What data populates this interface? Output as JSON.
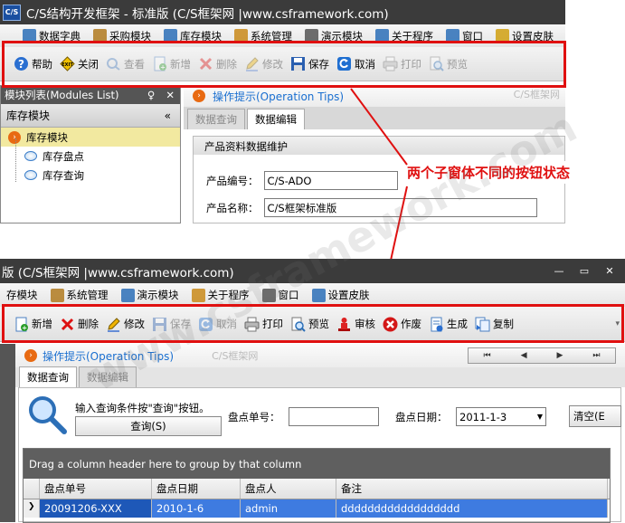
{
  "window1": {
    "app_icon_text": "C/S",
    "title": "C/S结构开发框架 - 标准版 (C/S框架网 |www.csframework.com)",
    "menu": [
      "数据字典",
      "采购模块",
      "库存模块",
      "系统管理",
      "演示模块",
      "关于程序",
      "窗口",
      "设置皮肤"
    ],
    "toolbar": [
      {
        "label": "帮助",
        "icon": "help-icon",
        "enabled": true
      },
      {
        "label": "关闭",
        "icon": "exit-icon",
        "enabled": true
      },
      {
        "label": "查看",
        "icon": "view-icon",
        "enabled": false
      },
      {
        "label": "新增",
        "icon": "add-icon",
        "enabled": false
      },
      {
        "label": "删除",
        "icon": "delete-icon",
        "enabled": false
      },
      {
        "label": "修改",
        "icon": "edit-icon",
        "enabled": false
      },
      {
        "label": "保存",
        "icon": "save-icon",
        "enabled": true
      },
      {
        "label": "取消",
        "icon": "cancel-icon",
        "enabled": true
      },
      {
        "label": "打印",
        "icon": "print-icon",
        "enabled": false
      },
      {
        "label": "预览",
        "icon": "preview-icon",
        "enabled": false
      }
    ],
    "modules_panel": {
      "title": "模块列表(Modules List)",
      "pin": "♀",
      "close": "✕",
      "nav_title": "库存模块",
      "collapse": "«",
      "tree": [
        "库存模块",
        "库存盘点",
        "库存查询"
      ]
    },
    "tips": "操作提示(Operation Tips)",
    "watermark": "C/S框架网",
    "tabs": [
      "数据查询",
      "数据编辑"
    ],
    "group_title": "产品资料数据维护",
    "fields": [
      {
        "label": "产品编号：",
        "value": "C/S-ADO"
      },
      {
        "label": "产品名称：",
        "value": "C/S框架标准版"
      }
    ]
  },
  "annotation": "两个子窗体不同的按钮状态",
  "window2": {
    "title": "版 (C/S框架网 |www.csframework.com)",
    "controls": [
      "—",
      "▭",
      "✕"
    ],
    "menu": [
      "存模块",
      "系统管理",
      "演示模块",
      "关于程序",
      "窗口",
      "设置皮肤"
    ],
    "toolbar": [
      {
        "label": "新增",
        "icon": "add-icon",
        "enabled": true
      },
      {
        "label": "删除",
        "icon": "delete-icon",
        "enabled": true
      },
      {
        "label": "修改",
        "icon": "edit-icon",
        "enabled": true
      },
      {
        "label": "保存",
        "icon": "save-icon",
        "enabled": false
      },
      {
        "label": "取消",
        "icon": "cancel-icon",
        "enabled": false
      },
      {
        "label": "打印",
        "icon": "print-icon",
        "enabled": true
      },
      {
        "label": "预览",
        "icon": "preview-icon",
        "enabled": true
      },
      {
        "label": "审核",
        "icon": "approve-icon",
        "enabled": true
      },
      {
        "label": "作废",
        "icon": "void-icon",
        "enabled": true
      },
      {
        "label": "生成",
        "icon": "generate-icon",
        "enabled": true
      },
      {
        "label": "复制",
        "icon": "copy-icon",
        "enabled": true
      }
    ],
    "tips": "操作提示(Operation Tips)",
    "watermark": "C/S框架网",
    "watermark_big": "www.csframework.com",
    "tabs": [
      "数据查询",
      "数据编辑"
    ],
    "nav_buttons": [
      "⏮",
      "◀",
      "▶",
      "⏭"
    ],
    "search_hint": "输入查询条件按\"查询\"按钮。",
    "search_button": "查询(S)",
    "doc_no_label": "盘点单号：",
    "doc_no_value": "",
    "date_label": "盘点日期：",
    "date_value": "2011-1-3",
    "clear_button": "清空(E",
    "group_hint": "Drag a column header here to group by that column",
    "columns": [
      "盘点单号",
      "盘点日期",
      "盘点人",
      "备注"
    ],
    "rows": [
      [
        "20091206-XXX",
        "2010-1-6",
        "admin",
        "dddddddddddddddddd"
      ]
    ]
  }
}
